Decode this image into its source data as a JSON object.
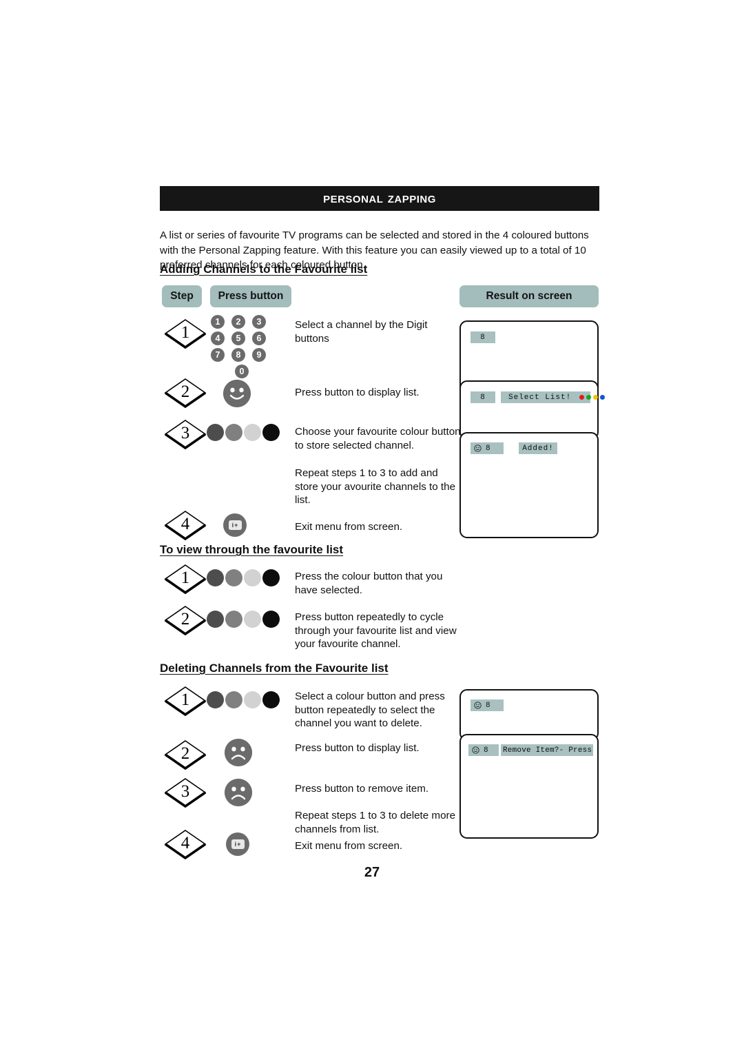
{
  "header": {
    "title": "Personal Zapping"
  },
  "intro": {
    "paragraph": "A list or series of favourite TV programs can be selected and stored in the 4 coloured buttons with the Personal Zapping feature. With this feature you can easily viewed up to a total of 10 preferred channels for each coloured button."
  },
  "table_headers": {
    "step": "Step",
    "press_button": "Press button",
    "result_on_screen": "Result on screen"
  },
  "sections": [
    {
      "id": "adding",
      "heading": "Adding Channels to the Favourite list",
      "steps": [
        {
          "number": "1",
          "text": "Select a channel by the Digit buttons",
          "icon": "digit-keypad"
        },
        {
          "number": "2",
          "text": "Press button to display list.",
          "icon": "smiley-face-button"
        },
        {
          "number": "3",
          "text": "Choose your favourite colour button to store selected channel.",
          "icon": "colour-buttons"
        },
        {
          "number": "",
          "text": "Repeat steps 1 to 3 to add and store your avourite channels to the list.",
          "icon": "none"
        },
        {
          "number": "4",
          "text": "Exit menu from screen.",
          "icon": "menu-button"
        }
      ]
    },
    {
      "id": "view",
      "heading": "To view through the favourite list",
      "steps": [
        {
          "number": "1",
          "text": "Press the colour button that you have selected.",
          "icon": "colour-buttons"
        },
        {
          "number": "2",
          "text": "Press button repeatedly to cycle through your favourite list and view your favourite channel.",
          "icon": "colour-buttons"
        }
      ]
    },
    {
      "id": "delete",
      "heading": "Deleting Channels from the Favourite list",
      "steps": [
        {
          "number": "1",
          "text": "Select a colour button and press button repeatedly to select the channel you want to delete.",
          "icon": "colour-buttons"
        },
        {
          "number": "2",
          "text": "Press button to display list.",
          "icon": "sad-face-button"
        },
        {
          "number": "3",
          "text": "Press button to remove item.",
          "icon": "sad-face-button"
        },
        {
          "number": "",
          "text": "Repeat steps 1 to 3 to delete more channels from list.",
          "icon": "none"
        },
        {
          "number": "4",
          "text": "Exit menu from screen.",
          "icon": "menu-button"
        }
      ]
    }
  ],
  "keypad": {
    "rows": [
      [
        "1",
        "2",
        "3"
      ],
      [
        "4",
        "5",
        "6"
      ],
      [
        "7",
        "8",
        "9"
      ]
    ],
    "last": "0"
  },
  "colour_buttons": {
    "labels": [
      "red-button",
      "green-button",
      "yellow-button",
      "blue-button"
    ],
    "swatches": [
      "#4d4d4d",
      "#808080",
      "#d2d2d2",
      "#0d0d0d"
    ]
  },
  "menu_button": {
    "glyph_left": "i",
    "glyph_right": "+"
  },
  "result_screens_add": [
    {
      "channel": "8",
      "osd": "",
      "dots": []
    },
    {
      "channel": "8",
      "osd": "Select List!",
      "dots": [
        "#e01b1b",
        "#14a81e",
        "#f2c400",
        "#1455d6"
      ]
    },
    {
      "channel": "8",
      "osd": "Added!",
      "dots": []
    }
  ],
  "result_screens_delete": [
    {
      "channel": "8",
      "osd": ""
    },
    {
      "channel": "8",
      "osd": "Remove Item?- Press"
    }
  ],
  "osd_colors": {
    "bar_background": "#a8c0c0",
    "red": "#e01b1b",
    "green": "#14a81e",
    "yellow": "#f2c400",
    "blue": "#1455d6"
  },
  "footer": {
    "page_number": "27"
  }
}
